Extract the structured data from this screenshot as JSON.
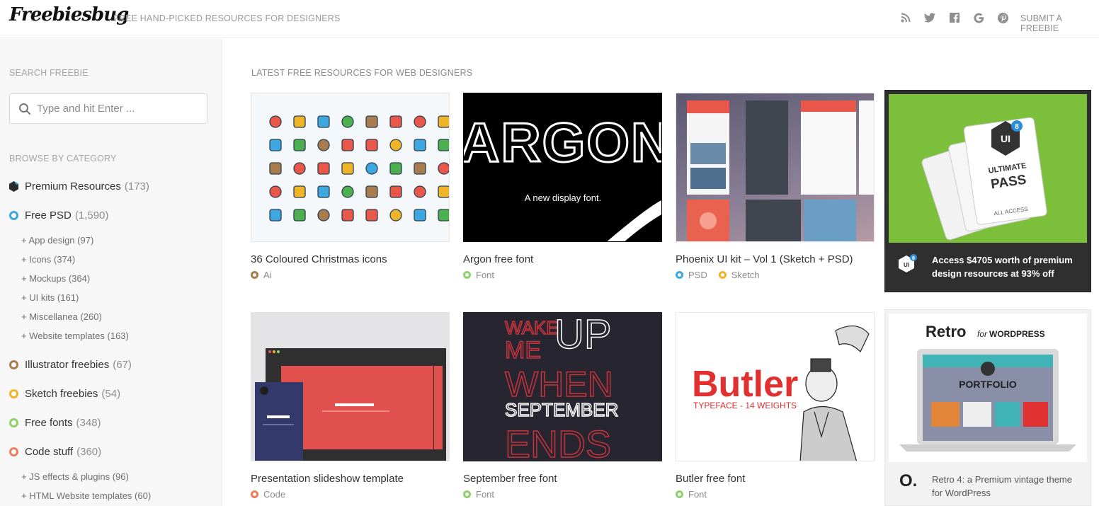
{
  "header": {
    "logo": "Freebiesbug",
    "tagline": "FREE HAND-PICKED RESOURCES FOR DESIGNERS",
    "icons": [
      "rss-icon",
      "twitter-icon",
      "facebook-icon",
      "google-icon",
      "pinterest-icon"
    ],
    "submit_label": "SUBMIT A FREEBIE"
  },
  "sidebar": {
    "search_heading": "SEARCH FREEBIE",
    "search_placeholder": "Type and hit Enter ...",
    "browse_heading": "BROWSE BY CATEGORY",
    "categories": [
      {
        "label": "Premium Resources",
        "count": "(173)",
        "color": "#2b2b2b"
      },
      {
        "label": "Free PSD",
        "count": "(1,590)",
        "color": "#3ea7e0"
      },
      {
        "label": "Illustrator freebies",
        "count": "(67)",
        "color": "#a87c4e"
      },
      {
        "label": "Sketch freebies",
        "count": "(54)",
        "color": "#f0b429"
      },
      {
        "label": "Free fonts",
        "count": "(348)",
        "color": "#8fd16a"
      },
      {
        "label": "Code stuff",
        "count": "(360)",
        "color": "#ee7c5e"
      }
    ],
    "psd_sub": [
      "+ App design (97)",
      "+ Icons (374)",
      "+ Mockups (364)",
      "+ UI kits (161)",
      "+ Miscellanea (260)",
      "+ Website templates (163)"
    ],
    "code_sub": [
      "+ JS effects & plugins (96)",
      "+ HTML Website templates (60)"
    ]
  },
  "main": {
    "heading": "LATEST FREE RESOURCES FOR WEB DESIGNERS",
    "cards": [
      {
        "title": "36 Coloured Christmas icons",
        "tags": [
          {
            "label": "Ai",
            "color": "#a87c4e"
          }
        ]
      },
      {
        "title": "Argon free font",
        "thumb_word": "ARGON",
        "thumb_caption": "A new display font.",
        "tags": [
          {
            "label": "Font",
            "color": "#8fd16a"
          }
        ]
      },
      {
        "title": "Phoenix UI kit – Vol 1 (Sketch + PSD)",
        "tags": [
          {
            "label": "PSD",
            "color": "#3ea7e0"
          },
          {
            "label": "Sketch",
            "color": "#f0b429"
          }
        ]
      },
      {
        "title": "Presentation slideshow template",
        "tags": [
          {
            "label": "Code",
            "color": "#ee7c5e"
          }
        ]
      },
      {
        "title": "September free font",
        "thumb_lines": [
          "WAKE",
          "UP",
          "ME",
          "WHEN",
          "SEPTEMBER",
          "ENDS"
        ],
        "tags": [
          {
            "label": "Font",
            "color": "#8fd16a"
          }
        ]
      },
      {
        "title": "Butler free font",
        "thumb_word": "Butler",
        "thumb_caption": "TYPEFACE - 14 WEIGHTS",
        "tags": [
          {
            "label": "Font",
            "color": "#8fd16a"
          }
        ]
      }
    ],
    "ads": [
      {
        "text": "Access $4705 worth of premium design resources at 93% off",
        "art_lines": [
          "UI",
          "ULTIMATE",
          "PASS",
          "ALL ACCESS"
        ]
      },
      {
        "text": "Retro 4: a Premium vintage theme for WordPress",
        "logo": "O.",
        "art_title": "Retro",
        "art_for": "for",
        "art_wp": "WORDPRESS",
        "art_brand": "PORTFOLIO"
      }
    ]
  }
}
